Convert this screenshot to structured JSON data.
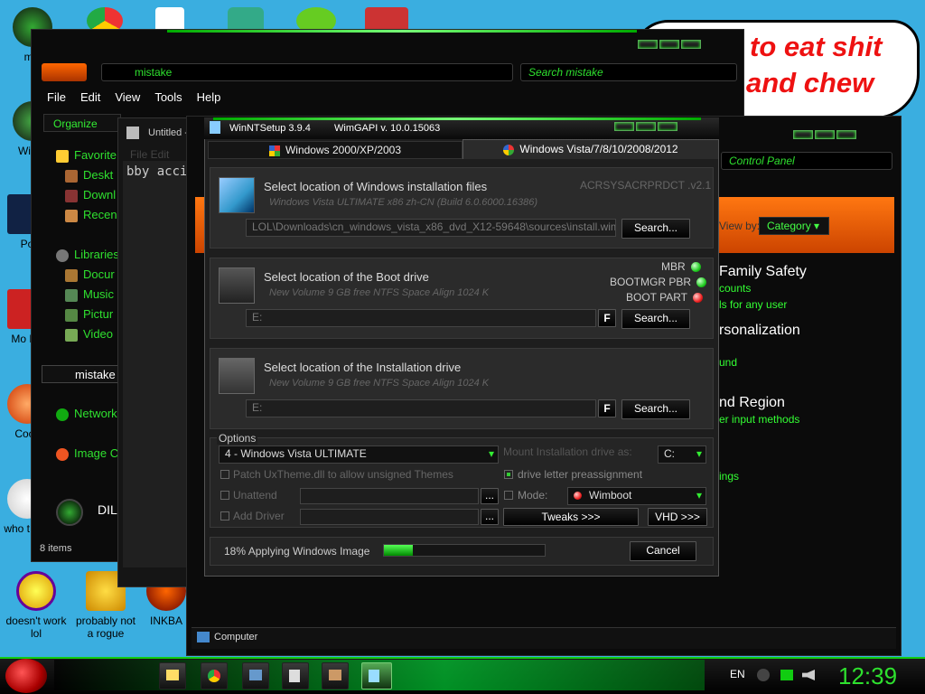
{
  "desktop": {
    "icons": [
      {
        "label": "mis"
      },
      {
        "label": "Win V"
      },
      {
        "label": "Po"
      },
      {
        "label": "Mo Re"
      },
      {
        "label": "Cock"
      },
      {
        "label": "who t use"
      },
      {
        "label": "doesn't work lol"
      },
      {
        "label": "probably not a rogue"
      },
      {
        "label": "INKBA"
      }
    ],
    "speech_bubble": {
      "line1": "to eat shit",
      "line2": "and chew"
    }
  },
  "explorer": {
    "address": "mistake",
    "search_placeholder": "Search mistake",
    "menu": [
      "File",
      "Edit",
      "View",
      "Tools",
      "Help"
    ],
    "organize_label": "Organize",
    "nav_items": [
      "Favorite",
      "Deskt",
      "Downl",
      "Recen",
      "Libraries",
      "Docur",
      "Music",
      "Pictur",
      "Video"
    ],
    "lower_items": [
      "mistake",
      "Network",
      "Image C",
      "DIL"
    ],
    "status": "8 items"
  },
  "notepad": {
    "title": "Untitled -",
    "menu": "File  Edit",
    "content": "bby acci"
  },
  "control_panel": {
    "search_placeholder": "Control Panel",
    "view_by_label": "View by:",
    "view_by_value": "Category",
    "sections": [
      {
        "title": "Family Safety",
        "links": [
          "counts",
          "ls for any user"
        ]
      },
      {
        "title": "rsonalization",
        "links": [
          "und"
        ]
      },
      {
        "title": "nd Region",
        "links": [
          "er input methods"
        ]
      },
      {
        "title": "",
        "links": [
          "ings"
        ]
      }
    ],
    "status": "Computer"
  },
  "winnt": {
    "title": "WinNTSetup 3.9.4",
    "wimgapi": "WimGAPI v. 10.0.15063",
    "tabs": [
      "Windows 2000/XP/2003",
      "Windows Vista/7/8/10/2008/2012"
    ],
    "install_files": {
      "title": "Select location of Windows installation files",
      "subtitle": "Windows Vista ULTIMATE x86 zh-CN (Build 6.0.6000.16386)",
      "code": "ACRSYSACRPRDCT .v2.1",
      "path": "LOL\\Downloads\\cn_windows_vista_x86_dvd_X12-59648\\sources\\install.wim",
      "search": "Search..."
    },
    "boot_drive": {
      "title": "Select location of the Boot drive",
      "subtitle": "New Volume 9 GB free NTFS Space Align 1024 K",
      "path": "E:",
      "f_label": "F",
      "search": "Search...",
      "status": [
        {
          "label": "MBR",
          "state": "green"
        },
        {
          "label": "BOOTMGR PBR",
          "state": "green"
        },
        {
          "label": "BOOT PART",
          "state": "red"
        }
      ]
    },
    "install_drive": {
      "title": "Select location of the Installation drive",
      "subtitle": "New Volume 9 GB free NTFS Space Align 1024 K",
      "path": "E:",
      "f_label": "F",
      "search": "Search..."
    },
    "options": {
      "legend": "Options",
      "edition": "4 - Windows Vista ULTIMATE",
      "mount_label": "Mount Installation drive as:",
      "mount_value": "C:",
      "patch_uxtheme": "Patch UxTheme.dll to allow unsigned Themes",
      "drive_letter": "drive letter preassignment",
      "unattend": "Unattend",
      "mode_label": "Mode:",
      "mode_value": "Wimboot",
      "add_drivers": "Add Driver",
      "tweaks": "Tweaks >>>",
      "vhd": "VHD >>>",
      "browse": "..."
    },
    "progress": {
      "text": "18% Applying Windows Image",
      "value": 0.18
    },
    "cancel": "Cancel"
  },
  "taskbar": {
    "language": "EN",
    "clock": "12:39"
  }
}
